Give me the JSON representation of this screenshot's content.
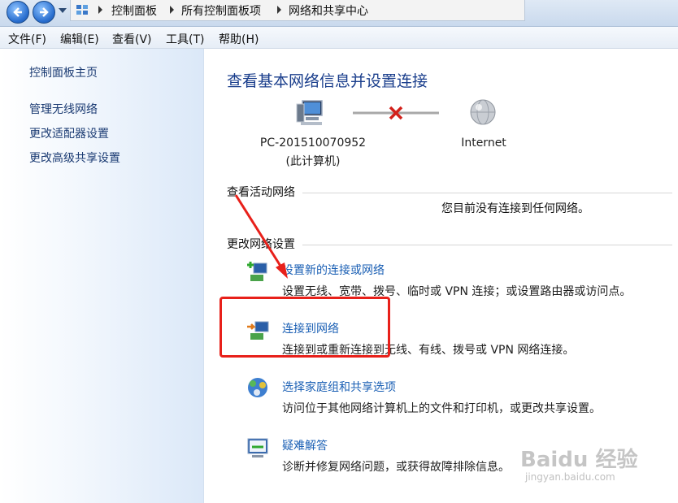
{
  "address_bar": {
    "crumbs": [
      "控制面板",
      "所有控制面板项",
      "网络和共享中心"
    ]
  },
  "menu": {
    "items": [
      "文件(F)",
      "编辑(E)",
      "查看(V)",
      "工具(T)",
      "帮助(H)"
    ]
  },
  "sidebar": {
    "home": "控制面板主页",
    "links": [
      "管理无线网络",
      "更改适配器设置",
      "更改高级共享设置"
    ]
  },
  "main": {
    "title": "查看基本网络信息并设置连接",
    "computer_name": "PC-201510070952",
    "computer_sub": "(此计算机)",
    "internet_label": "Internet",
    "active_heading": "查看活动网络",
    "no_connection": "您目前没有连接到任何网络。",
    "change_heading": "更改网络设置",
    "tasks": [
      {
        "title": "设置新的连接或网络",
        "desc": "设置无线、宽带、拨号、临时或 VPN 连接；或设置路由器或访问点。",
        "icon": "new-connection-icon"
      },
      {
        "title": "连接到网络",
        "desc": "连接到或重新连接到无线、有线、拨号或 VPN 网络连接。",
        "icon": "connect-network-icon"
      },
      {
        "title": "选择家庭组和共享选项",
        "desc": "访问位于其他网络计算机上的文件和打印机，或更改共享设置。",
        "icon": "homegroup-icon"
      },
      {
        "title": "疑难解答",
        "desc": "诊断并修复网络问题，或获得故障排除信息。",
        "icon": "troubleshoot-icon"
      }
    ]
  },
  "watermark": {
    "brand": "Baidu 经验",
    "url": "jingyan.baidu.com"
  },
  "colors": {
    "link": "#1a5fb4",
    "title": "#1a3e8c",
    "annotation": "#e8201a"
  }
}
